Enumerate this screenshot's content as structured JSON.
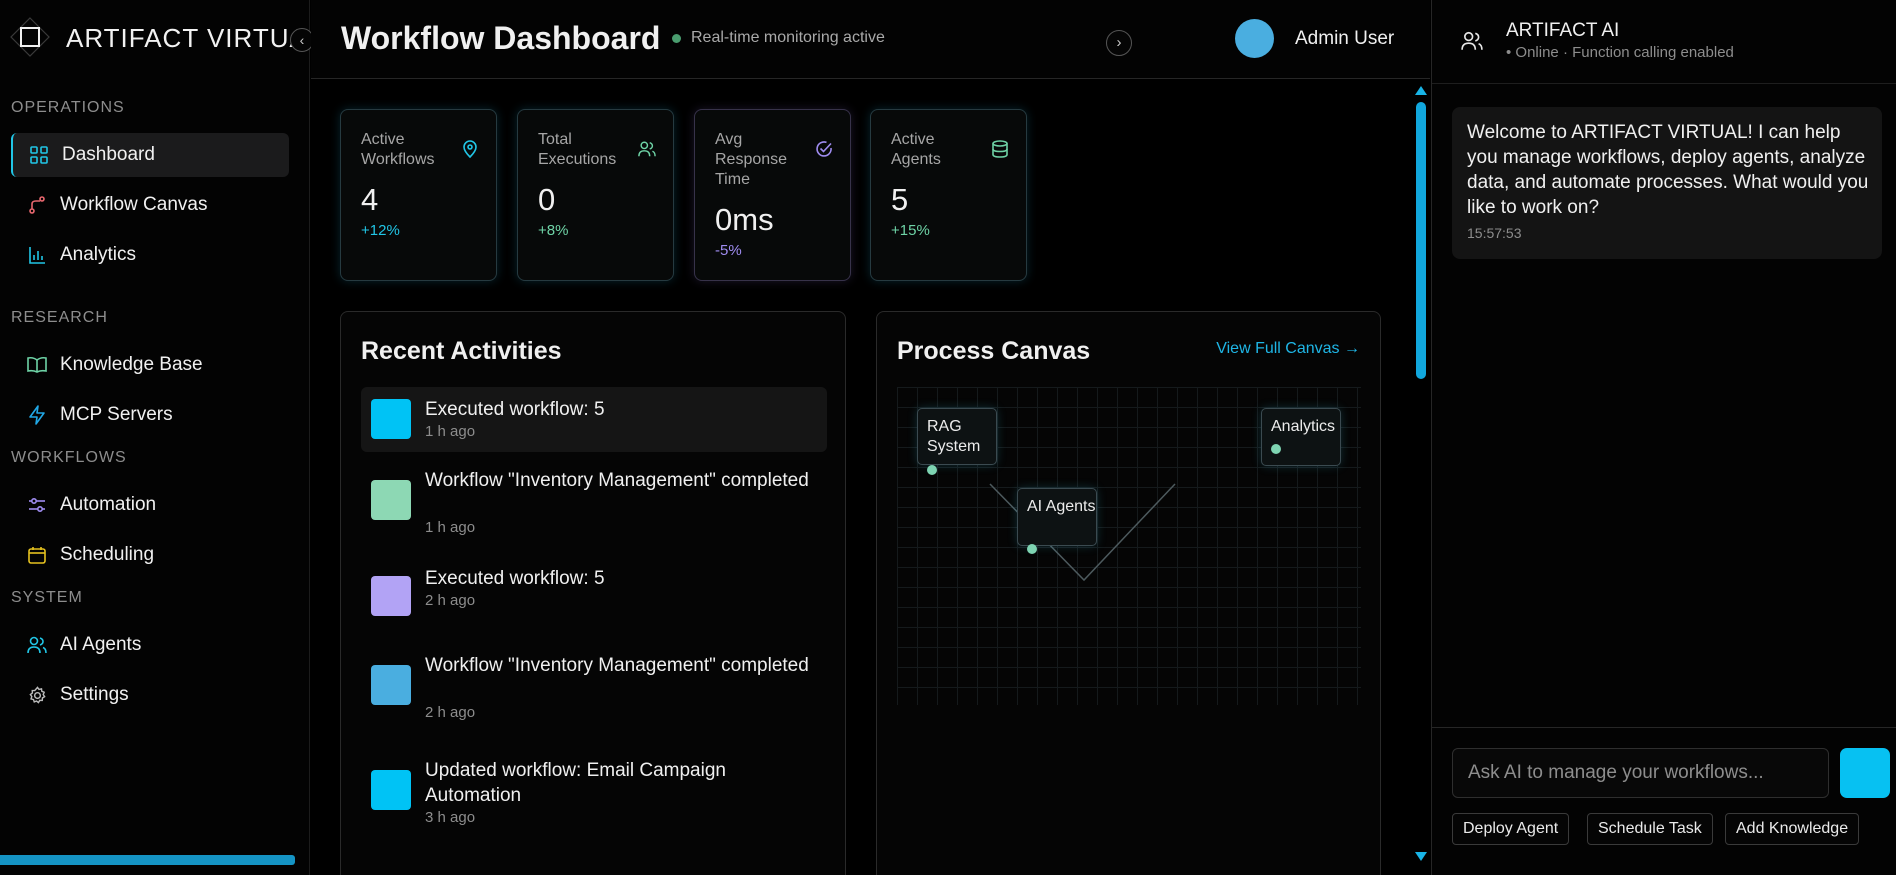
{
  "app": {
    "brand": "ARTIFACT VIRTUAL",
    "accent": "#21c6e6"
  },
  "sidebar": {
    "collapse_icon": "chevron-left-icon",
    "sections": [
      {
        "label": "OPERATIONS"
      },
      {
        "label": "RESEARCH"
      },
      {
        "label": "WORKFLOWS"
      },
      {
        "label": "SYSTEM"
      }
    ],
    "items": [
      {
        "label": "Dashboard",
        "icon": "grid-icon",
        "active": true
      },
      {
        "label": "Workflow Canvas",
        "icon": "git-branch-icon"
      },
      {
        "label": "Analytics",
        "icon": "bar-chart-icon"
      },
      {
        "label": "Knowledge Base",
        "icon": "book-icon"
      },
      {
        "label": "MCP Servers",
        "icon": "lightning-icon"
      },
      {
        "label": "Automation",
        "icon": "sliders-icon"
      },
      {
        "label": "Scheduling",
        "icon": "calendar-icon"
      },
      {
        "label": "AI Agents",
        "icon": "users-icon"
      },
      {
        "label": "Settings",
        "icon": "gear-icon"
      }
    ]
  },
  "header": {
    "title": "Workflow Dashboard",
    "status": "Real-time monitoring active",
    "status_color": "#4a9d6f",
    "user_name": "Admin User",
    "avatar_color": "#4aaee0"
  },
  "stats": [
    {
      "label": "Active Workflows",
      "value": "4",
      "delta": "+12%",
      "icon": "map-pin-icon",
      "color": "#21c6e6"
    },
    {
      "label": "Total Executions",
      "value": "0",
      "delta": "+8%",
      "icon": "users-icon",
      "color": "#6ed3a6"
    },
    {
      "label": "Avg Response Time",
      "value": "0ms",
      "delta": "-5%",
      "icon": "check-circle-icon",
      "color": "#9f8cf0"
    },
    {
      "label": "Active Agents",
      "value": "5",
      "delta": "+15%",
      "icon": "database-icon",
      "color": "#6ed3a6"
    }
  ],
  "activities": {
    "title": "Recent Activities",
    "items": [
      {
        "text": "Executed workflow: 5",
        "time": "1 h ago",
        "color": "#00c3f5"
      },
      {
        "text": "Workflow \"Inventory Management\" completed",
        "time": "1 h ago",
        "color": "#8dd8b4"
      },
      {
        "text": "Executed workflow: 5",
        "time": "2 h ago",
        "color": "#b2a3f5"
      },
      {
        "text": "Workflow \"Inventory Management\" completed",
        "time": "2 h ago",
        "color": "#4aaee0"
      },
      {
        "text": "Updated workflow: Email Campaign Automation",
        "time": "3 h ago",
        "color": "#00c3f5"
      }
    ]
  },
  "canvas": {
    "title": "Process Canvas",
    "link": "View Full Canvas →",
    "nodes": [
      {
        "label": "RAG System"
      },
      {
        "label": "AI Agents"
      },
      {
        "label": "Analytics"
      }
    ]
  },
  "chat": {
    "title": "ARTIFACT AI",
    "subtitle": "• Online · Function calling enabled",
    "header_icon": "users-icon",
    "message": "Welcome to ARTIFACT VIRTUAL! I can help you manage workflows, deploy agents, analyze data, and automate processes. What would you like to work on?",
    "message_time": "15:57:53",
    "input_placeholder": "Ask AI to manage your workflows...",
    "send_color": "#07c1f2",
    "quick_actions": [
      "Deploy Agent",
      "Schedule Task",
      "Add Knowledge"
    ]
  }
}
